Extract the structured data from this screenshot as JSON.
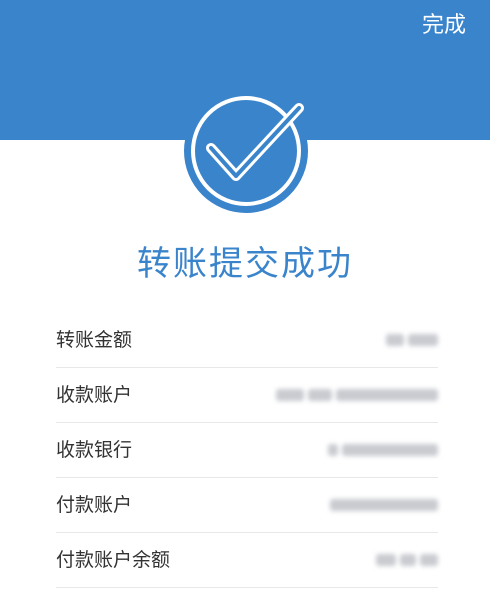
{
  "header": {
    "done_label": "完成"
  },
  "result": {
    "title": "转账提交成功",
    "icon": "check-circle-icon"
  },
  "details": [
    {
      "label": "转账金额",
      "value_obscured": true
    },
    {
      "label": "收款账户",
      "value_obscured": true
    },
    {
      "label": "收款银行",
      "value_obscured": true
    },
    {
      "label": "付款账户",
      "value_obscured": true
    },
    {
      "label": "付款账户余额",
      "value_obscured": true
    }
  ],
  "colors": {
    "primary": "#3a84cc",
    "background": "#ffffff",
    "label_text": "#333333",
    "divider": "#e8e8e8"
  }
}
